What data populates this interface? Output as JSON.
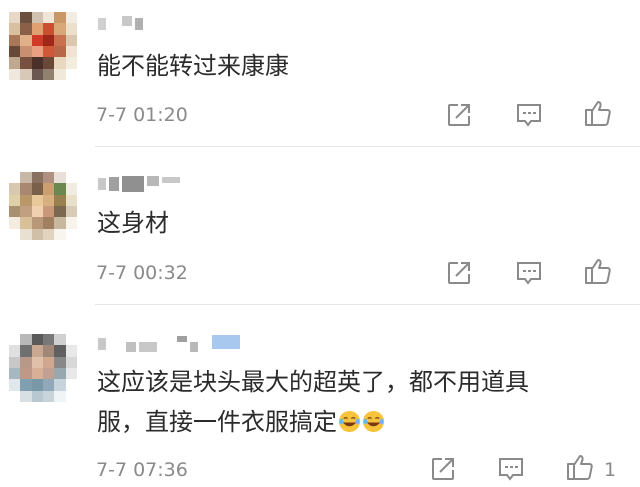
{
  "comments": [
    {
      "text": "能不能转过来康康",
      "time": "7-7 01:20",
      "like_count": ""
    },
    {
      "text": "这身材",
      "time": "7-7 00:32",
      "like_count": ""
    },
    {
      "text_line1": "这应该是块头最大的超英了，都不用道具",
      "text_line2": "服，直接一件衣服搞定",
      "time": "7-7 07:36",
      "like_count": "1"
    }
  ],
  "icons": {
    "share": "share-icon",
    "reply": "comment-icon",
    "like": "thumbs-up-icon",
    "emoji": "laughing-tears-emoji"
  },
  "colors": {
    "text": "#2b2b2b",
    "meta": "#8a8a8a",
    "icon": "#8a8a8a",
    "divider": "#e6e6e6",
    "username_accent": "#a8c8f0"
  }
}
